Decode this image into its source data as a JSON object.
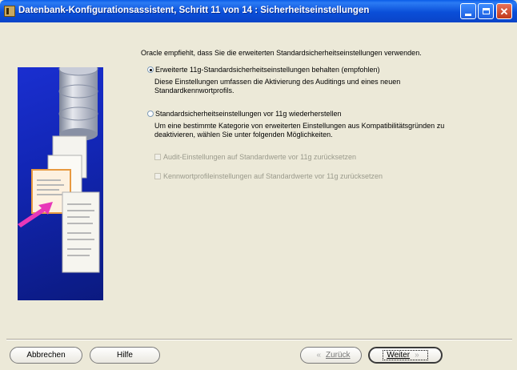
{
  "window": {
    "title": "Datenbank-Konfigurationsassistent, Schritt 11 von 14 : Sicherheitseinstellungen",
    "title_color": "#0A4ED8"
  },
  "intro": "Oracle empfiehlt, dass Sie die erweiterten Standardsicherheitseinstellungen verwenden.",
  "options": [
    {
      "label": "Erweiterte 11g-Standardsicherheitseinstellungen behalten (empfohlen)",
      "selected": true,
      "desc": [
        "Diese Einstellungen umfassen die Aktivierung des Auditings und eines neuen",
        "Standardkennwortprofils."
      ]
    },
    {
      "label": "Standardsicherheitseinstellungen vor 11g wiederherstellen",
      "selected": false,
      "desc": [
        "Um eine bestimmte Kategorie von erweiterten Einstellungen aus Kompatibilitätsgründen zu",
        "deaktivieren, wählen Sie unter folgenden Möglichkeiten."
      ]
    }
  ],
  "checkboxes": [
    {
      "label": "Audit-Einstellungen auf Standardwerte vor 11g zurücksetzen",
      "checked": false,
      "enabled": false
    },
    {
      "label": "Kennwortprofileinstellungen auf Standardwerte vor 11g zurücksetzen",
      "checked": false,
      "enabled": false
    }
  ],
  "buttons": {
    "cancel": "Abbrechen",
    "help": "Hilfe",
    "back": "Zurück",
    "next": "Weiter",
    "back_arrow": "«",
    "next_arrow": "»"
  }
}
